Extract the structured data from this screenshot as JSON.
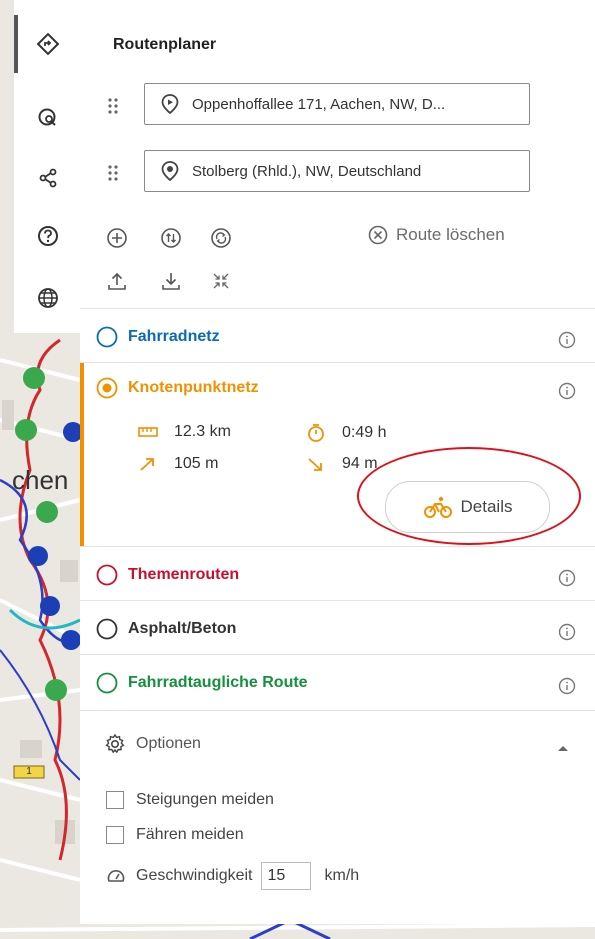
{
  "panel": {
    "title": "Routenplaner",
    "waypoints": [
      {
        "value": "Oppenhoffallee 171, Aachen, NW, D..."
      },
      {
        "value": "Stolberg (Rhld.), NW, Deutschland"
      }
    ],
    "clear_route_label": "Route löschen"
  },
  "map": {
    "place_label": "chen",
    "road_badge": "1"
  },
  "networks": [
    {
      "label": "Fahrradnetz",
      "color": "#0a6bb5"
    },
    {
      "label": "Knotenpunktnetz",
      "color": "#f29100",
      "stats": {
        "distance": "12.3 km",
        "duration": "0:49 h",
        "ascent": "105 m",
        "descent": "94 m"
      },
      "details_label": "Details"
    },
    {
      "label": "Themenrouten",
      "color": "#c8102e"
    },
    {
      "label": "Asphalt/Beton",
      "color": "#333333"
    },
    {
      "label": "Fahrradtaugliche Route",
      "color": "#13913c"
    }
  ],
  "options": {
    "title": "Optionen",
    "avoid_slopes": "Steigungen meiden",
    "avoid_ferries": "Fähren meiden",
    "speed_label": "Geschwindigkeit",
    "speed_value": "15",
    "speed_unit": "km/h"
  }
}
